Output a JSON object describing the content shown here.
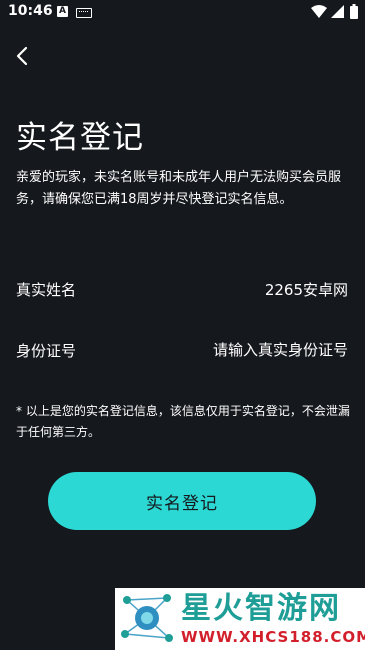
{
  "status_bar": {
    "time": "10:46",
    "notification_badge": "A"
  },
  "header": {
    "back_icon": "chevron-left-icon"
  },
  "page": {
    "title": "实名登记",
    "description": "亲爱的玩家，未实名账号和未成年人用户无法购买会员服务，请确保您已满18周岁并尽快登记实名信息。"
  },
  "form": {
    "name_label": "真实姓名",
    "name_value": "2265安卓网",
    "id_label": "身份证号",
    "id_value": "",
    "id_placeholder": "请输入真实身份证号"
  },
  "note": "* 以上是您的实名登记信息，该信息仅用于实名登记，不会泄漏于任何第三方。",
  "submit_label": "实名登记",
  "watermark": {
    "title": "星火智游网",
    "url": "WWW.XHCS188.COM"
  },
  "colors": {
    "background": "#15181d",
    "accent": "#2bd8d3",
    "watermark_teal": "#1f9e97",
    "watermark_red": "#d21f2b"
  }
}
